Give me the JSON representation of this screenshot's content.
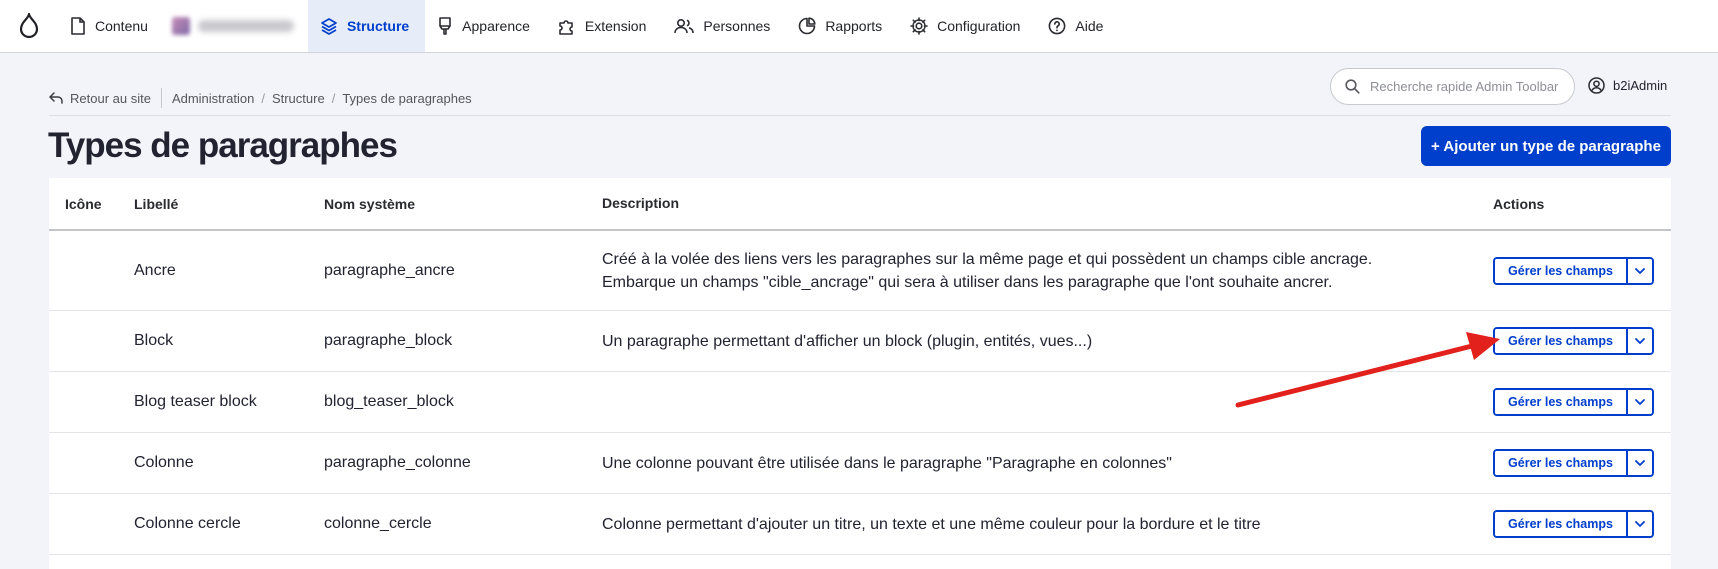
{
  "toolbar": {
    "items": [
      {
        "label": "Contenu",
        "icon": "page-icon"
      },
      {
        "label": "Structure",
        "icon": "layers-icon",
        "active": true
      },
      {
        "label": "Apparence",
        "icon": "brush-icon"
      },
      {
        "label": "Extension",
        "icon": "puzzle-icon"
      },
      {
        "label": "Personnes",
        "icon": "people-icon"
      },
      {
        "label": "Rapports",
        "icon": "chart-icon"
      },
      {
        "label": "Configuration",
        "icon": "gear-icon"
      },
      {
        "label": "Aide",
        "icon": "help-icon"
      }
    ]
  },
  "breadcrumb": {
    "back": "Retour au site",
    "items": [
      "Administration",
      "Structure",
      "Types de paragraphes"
    ]
  },
  "search": {
    "placeholder": "Recherche rapide Admin Toolbar"
  },
  "user": {
    "name": "b2iAdmin"
  },
  "page": {
    "title": "Types de paragraphes",
    "add_button": "+ Ajouter un type de paragraphe"
  },
  "table": {
    "headers": {
      "icon": "Icône",
      "label": "Libellé",
      "system": "Nom système",
      "description": "Description",
      "actions": "Actions"
    },
    "action_label": "Gérer les champs",
    "rows": [
      {
        "label": "Ancre",
        "system": "paragraphe_ancre",
        "description": "Créé à la volée des liens vers les paragraphes sur la même page et qui possèdent un champs cible ancrage.\nEmbarque un champs \"cible_ancrage\" qui sera à utiliser dans les paragraphe que l'ont souhaite ancrer."
      },
      {
        "label": "Block",
        "system": "paragraphe_block",
        "description": "Un paragraphe permettant d'afficher un block (plugin, entités, vues...)"
      },
      {
        "label": "Blog teaser block",
        "system": "blog_teaser_block",
        "description": ""
      },
      {
        "label": "Colonne",
        "system": "paragraphe_colonne",
        "description": "Une colonne pouvant être utilisée dans le paragraphe \"Paragraphe en colonnes\""
      },
      {
        "label": "Colonne cercle",
        "system": "colonne_cercle",
        "description": "Colonne permettant d'ajouter un titre, un texte et une même couleur pour la bordure et le titre"
      }
    ]
  },
  "colors": {
    "accent": "#003ecc",
    "annotation_arrow": "#e3211c"
  }
}
